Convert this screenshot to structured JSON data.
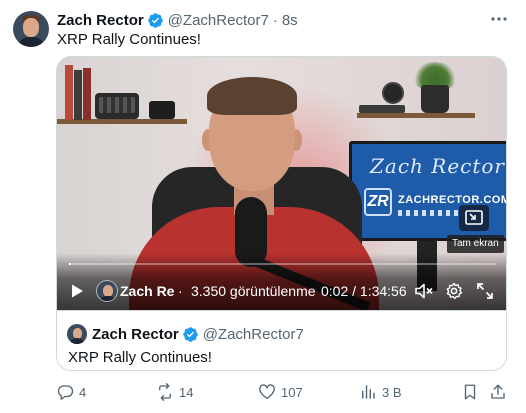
{
  "tweet": {
    "author": {
      "name": "Zach Rector",
      "handle": "@ZachRector7",
      "separator": "·",
      "time": "8s"
    },
    "text": "XRP Rally Continues!",
    "more_icon": "more-horizontal-icon"
  },
  "video": {
    "monitor": {
      "title": "Zach Rector",
      "logo": "ZR",
      "url": "ZACHRECTOR.COM"
    },
    "controls": {
      "channel_name": "Zach Rec",
      "separator": "·",
      "views": "3.350 görüntülenme",
      "time": "0:02 / 1:34:56",
      "progress": 0.0004
    },
    "tooltip": "Tam ekran"
  },
  "quote": {
    "name": "Zach Rector",
    "handle": "@ZachRector7",
    "text": "XRP Rally Continues!"
  },
  "actions": {
    "replies": "4",
    "reposts": "14",
    "likes": "107",
    "views": "3 B"
  },
  "colors": {
    "verified": "#1d9bf0",
    "muted": "#536471",
    "border": "#cfd9de",
    "shirt": "#b8322f",
    "monitor": "#1e5ba8"
  }
}
